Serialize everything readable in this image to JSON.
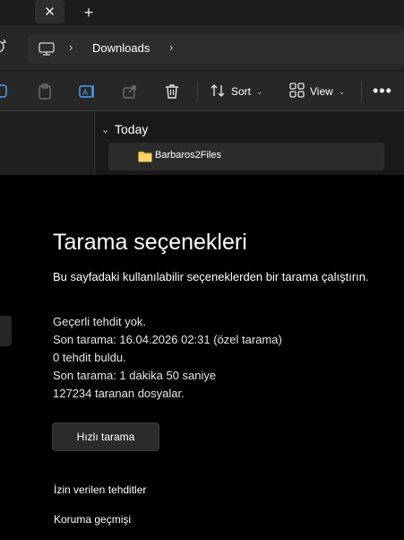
{
  "explorer": {
    "tabs": {
      "close_glyph": "✕",
      "new_tab_glyph": "+"
    },
    "address": {
      "refresh_icon": "refresh-icon",
      "location_icon": "monitor-icon",
      "separator_glyph": "›",
      "current_folder": "Downloads"
    },
    "commandbar": {
      "sort_label": "Sort",
      "view_label": "View",
      "dropdown_glyph": "⌄",
      "more_glyph": "•••"
    },
    "files": {
      "group_label": "Today",
      "group_chevron": "⌄",
      "items": [
        {
          "name": "Barbaros2Files",
          "icon": "folder-icon"
        }
      ]
    }
  },
  "security": {
    "title": "Tarama seçenekleri",
    "description": "Bu sayfadaki kullanılabilir seçeneklerden bir tarama çalıştırın.",
    "status_lines": [
      "Geçerli tehdit yok.",
      "Son tarama: 16.04.2026 02:31 (özel tarama)",
      "0 tehdit buldu.",
      "Son tarama: 1 dakika 50 saniye",
      "127234 taranan dosyalar."
    ],
    "quick_scan_label": "Hızlı tarama",
    "links": [
      "İzin verilen tehditler",
      "Koruma geçmişi"
    ]
  },
  "colors": {
    "explorer_bg": "#202020",
    "panel_bg": "#000000",
    "folder_yellow": "#f4c542"
  }
}
